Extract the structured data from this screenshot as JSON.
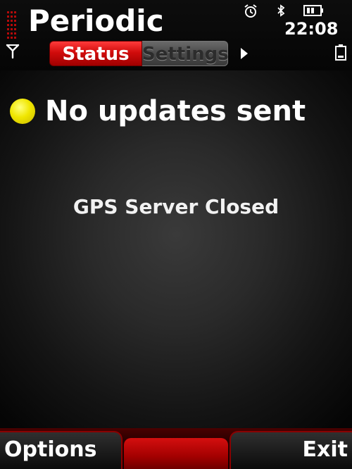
{
  "header": {
    "title": "Periodic",
    "clock": "22:08",
    "icons": {
      "signal": "signal-strength-icon",
      "antenna": "antenna-icon",
      "alarm": "alarm-clock-icon",
      "bluetooth": "bluetooth-icon",
      "battery_top": "battery-indicator-icon",
      "battery": "battery-level-icon"
    }
  },
  "tabs": {
    "items": [
      {
        "label": "Status",
        "active": true
      },
      {
        "label": "Settings",
        "active": false
      }
    ],
    "next_icon": "chevron-right-icon"
  },
  "main": {
    "status_indicator": {
      "icon": "status-dot-icon",
      "color": "#f0e600"
    },
    "status_text": "No updates sent",
    "server_status": "GPS Server Closed"
  },
  "softkeys": {
    "left": "Options",
    "right": "Exit"
  },
  "colors": {
    "accent": "#d10c0c",
    "background": "#141414"
  }
}
